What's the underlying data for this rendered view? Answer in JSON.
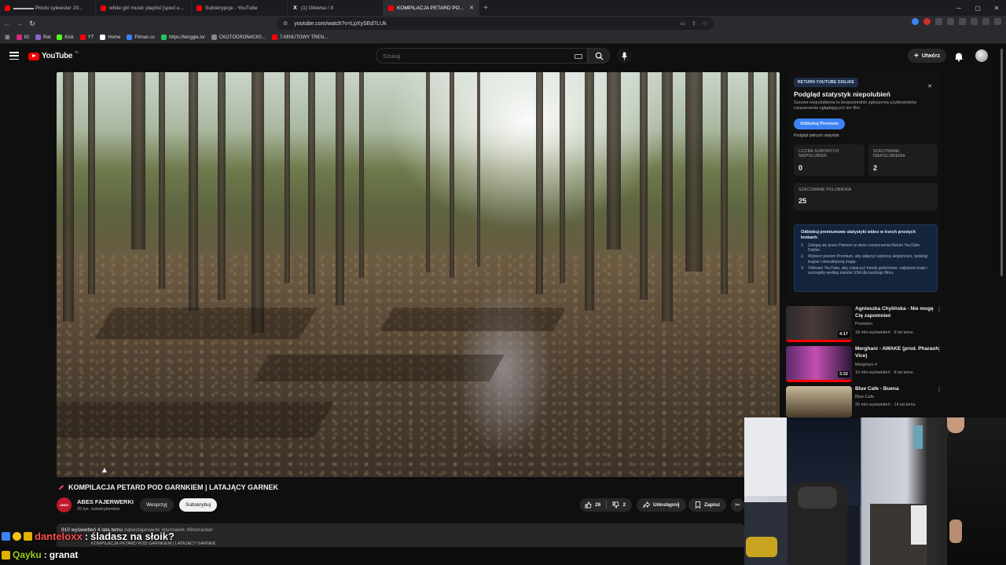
{
  "browser": {
    "tabs": [
      {
        "label": "▬▬▬▬ Płocki sylwester 20...",
        "kind": "yt",
        "active": false
      },
      {
        "label": "white girl music playlist [sped up] - Y...",
        "kind": "yt",
        "active": false
      },
      {
        "label": "Subskrypcje - YouTube",
        "kind": "yt",
        "active": false
      },
      {
        "label": "(1) Główna / X",
        "kind": "x",
        "active": false
      },
      {
        "label": "KOMPILACJA PETARD PO...",
        "kind": "yt",
        "active": true
      }
    ],
    "url": "youtube.com/watch?v=LpXySEd7LUk",
    "bookmarks": [
      {
        "label": "IG",
        "color": "#d6287e"
      },
      {
        "label": "Rat",
        "color": "#8a63d2"
      },
      {
        "label": "Kick",
        "color": "#53fc18"
      },
      {
        "label": "YT",
        "color": "#ff0000"
      },
      {
        "label": "Home",
        "color": "#ffffff"
      },
      {
        "label": "Filman.cc",
        "color": "#3b82f6"
      },
      {
        "label": "https://tenggle.io/",
        "color": "#22c55e"
      },
      {
        "label": "CKOTODRON#CK0...",
        "color": "#888888"
      },
      {
        "label": "7-MINUTOWY TREN...",
        "color": "#ff0000"
      }
    ]
  },
  "youtube": {
    "logo": "YouTube",
    "country": "PL",
    "search_placeholder": "Szukaj",
    "create_label": "Utwórz"
  },
  "video": {
    "title": "KOMPILACJA PETARD POD GARNKIEM | LATAJĄCY GARNEK",
    "channel": "ABES FAJERWERKI",
    "channel_avatar": "ABES",
    "subscribers": "20 tys. subskrybentów",
    "join_label": "Wesprzyj",
    "subscribe_label": "Subskrybuj",
    "likes": "26",
    "dislikes": "2",
    "share_label": "Udostępnij",
    "save_label": "Zapisz",
    "views_age": "910 wyświetleń  4 lata temu",
    "hashtags": "#abesfajerwerki #pyrowerk #firecracker",
    "desc_line": "KOMPILACJA PETARD POD GARNKIEM | LATAJĄCY GARNEK"
  },
  "ryd": {
    "badge": "RETURN YOUTUBE DISLIKE",
    "title": "Podgląd statystyk niepolubień",
    "description": "Surowe niepolubienia to bezpośrednie zgłoszenia użytkowników rozszerzenia oglądających ten film.",
    "premium_button": "Odblokuj Premium",
    "full_stats": "Podgląd pełnych statystyk",
    "stats": [
      {
        "label": "LICZBA SUROWYCH NIEPOLUBIEŃ",
        "value": "0"
      },
      {
        "label": "SZACOWANE NIEPOLUBIENIA",
        "value": "2"
      },
      {
        "label": "SZACOWANE POLUBIENIA",
        "value": "25"
      }
    ],
    "promo_heading": "Odblokuj premiumowe statystyki wideo w trzech prostych krokach:",
    "promo_steps": [
      "Zaloguj się przez Patreon w oknie rozszerzenia Return YouTube Dislike.",
      "Wybierz poziom Premium, aby włączyć wykresy aktywności, rankingi krajów i interaktywną mapę.",
      "Odśwież YouTube, aby zobaczyć trendy godzinowe, najlepsze kraje i szczegóły według stanów USA dla każdego filmu."
    ]
  },
  "recommendations": [
    {
      "title": "Agnieszka Chylińska - Nie mogę Cię zapomnieć",
      "channel": "Pomaton",
      "meta": "18 mln wyświetleń · 9 lat temu",
      "duration": "4:17",
      "verified": false
    },
    {
      "title": "Merghani - AWAKE (prod. Pharaoh Vice)",
      "channel": "Merghani",
      "meta": "10 mln wyświetleń · 8 lat temu",
      "duration": "3:32",
      "verified": true
    },
    {
      "title": "Blue Cafe - Buena",
      "channel": "Blue Cafe",
      "meta": "20 mln wyświetleń · 14 lat temu",
      "duration": "",
      "verified": false
    }
  ],
  "chat": [
    {
      "user": "danteloxx",
      "message": "śladasz na słoik?",
      "color": "#ff4f4f"
    },
    {
      "user": "Qayku",
      "message": "granat",
      "color": "#9bd21f"
    }
  ],
  "colors": {
    "yt_red": "#ff0000",
    "ryd_blue": "#3b82f6",
    "background": "#0f0f0f"
  }
}
